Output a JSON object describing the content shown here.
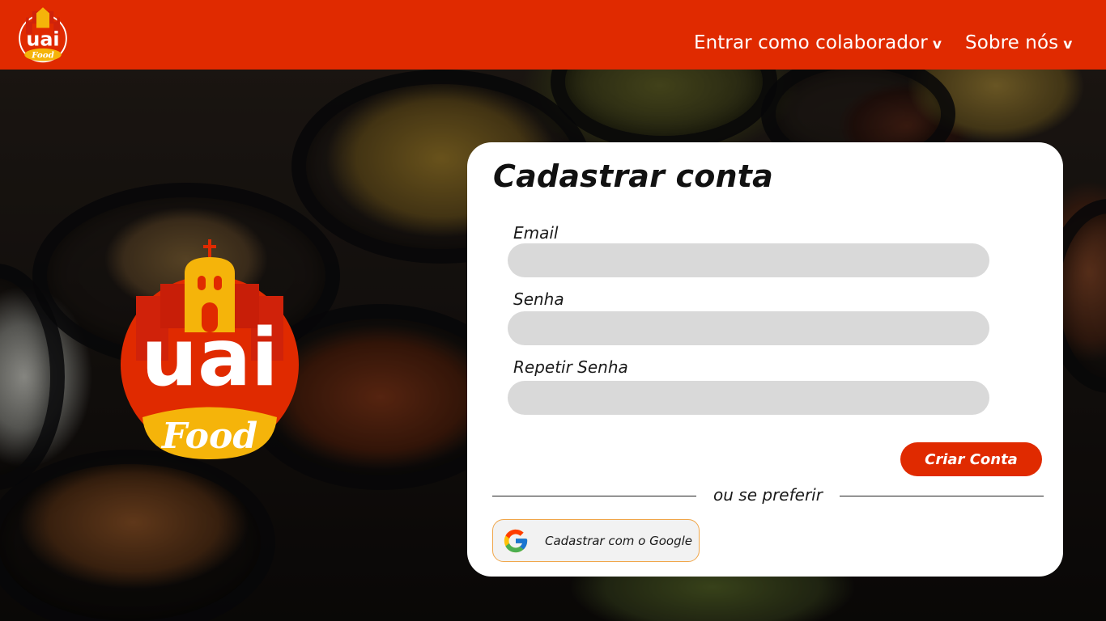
{
  "header": {
    "nav": [
      {
        "label": "Entrar como colaborador",
        "chevron": "v"
      },
      {
        "label": "Sobre nós",
        "chevron": "v"
      }
    ]
  },
  "brand": {
    "logo_word": "uai",
    "logo_sub": "Food",
    "primary_color": "#e02a00",
    "accent_color": "#f5b40a"
  },
  "signup": {
    "title": "Cadastrar conta",
    "fields": [
      {
        "label": "Email",
        "value": "",
        "placeholder": ""
      },
      {
        "label": "Senha",
        "value": "",
        "placeholder": ""
      },
      {
        "label": "Repetir Senha",
        "value": "",
        "placeholder": ""
      }
    ],
    "submit_label": "Criar Conta",
    "divider_text": "ou se preferir",
    "google_label": "Cadastrar com o Google",
    "google_icon": "google-icon"
  }
}
